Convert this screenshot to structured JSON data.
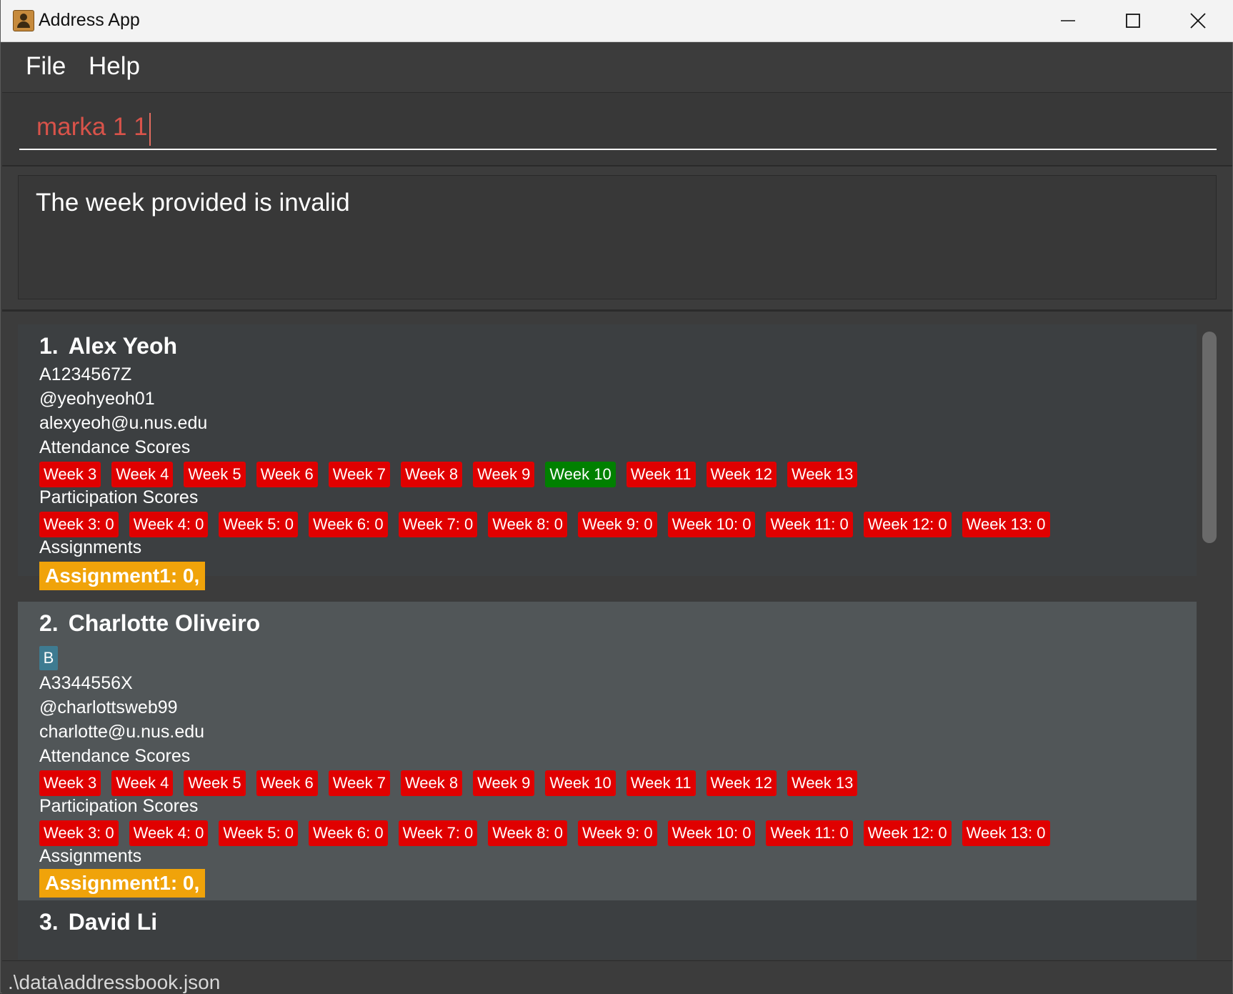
{
  "window": {
    "title": "Address App",
    "icon": "address-book-icon"
  },
  "menu": {
    "items": [
      {
        "label": "File"
      },
      {
        "label": "Help"
      }
    ]
  },
  "command": {
    "value": "marka 1 1",
    "color": "#d9534a"
  },
  "result": {
    "message": "The week provided is invalid"
  },
  "persons": [
    {
      "index": "1.",
      "name": "Alex Yeoh",
      "tags": [],
      "student_id": "A1234567Z",
      "telegram": "@yeohyeoh01",
      "email": "alexyeoh@u.nus.edu",
      "attendance_label": "Attendance Scores",
      "attendance": [
        {
          "label": "Week 3",
          "present": false
        },
        {
          "label": "Week 4",
          "present": false
        },
        {
          "label": "Week 5",
          "present": false
        },
        {
          "label": "Week 6",
          "present": false
        },
        {
          "label": "Week 7",
          "present": false
        },
        {
          "label": "Week 8",
          "present": false
        },
        {
          "label": "Week 9",
          "present": false
        },
        {
          "label": "Week 10",
          "present": true
        },
        {
          "label": "Week 11",
          "present": false
        },
        {
          "label": "Week 12",
          "present": false
        },
        {
          "label": "Week 13",
          "present": false
        }
      ],
      "participation_label": "Participation Scores",
      "participation": [
        "Week 3: 0",
        "Week 4: 0",
        "Week 5: 0",
        "Week 6: 0",
        "Week 7: 0",
        "Week 8: 0",
        "Week 9: 0",
        "Week 10: 0",
        "Week 11: 0",
        "Week 12: 0",
        "Week 13: 0"
      ],
      "assignments_label": "Assignments",
      "assignments": "Assignment1: 0,"
    },
    {
      "index": "2.",
      "name": "Charlotte Oliveiro",
      "tags": [
        "B"
      ],
      "student_id": "A3344556X",
      "telegram": "@charlottsweb99",
      "email": "charlotte@u.nus.edu",
      "attendance_label": "Attendance Scores",
      "attendance": [
        {
          "label": "Week 3",
          "present": false
        },
        {
          "label": "Week 4",
          "present": false
        },
        {
          "label": "Week 5",
          "present": false
        },
        {
          "label": "Week 6",
          "present": false
        },
        {
          "label": "Week 7",
          "present": false
        },
        {
          "label": "Week 8",
          "present": false
        },
        {
          "label": "Week 9",
          "present": false
        },
        {
          "label": "Week 10",
          "present": false
        },
        {
          "label": "Week 11",
          "present": false
        },
        {
          "label": "Week 12",
          "present": false
        },
        {
          "label": "Week 13",
          "present": false
        }
      ],
      "participation_label": "Participation Scores",
      "participation": [
        "Week 3: 0",
        "Week 4: 0",
        "Week 5: 0",
        "Week 6: 0",
        "Week 7: 0",
        "Week 8: 0",
        "Week 9: 0",
        "Week 10: 0",
        "Week 11: 0",
        "Week 12: 0",
        "Week 13: 0"
      ],
      "assignments_label": "Assignments",
      "assignments": "Assignment1: 0,"
    },
    {
      "index": "3.",
      "name": "David Li"
    }
  ],
  "status": {
    "path": ".\\data\\addressbook.json"
  },
  "colors": {
    "absent": "#e00000",
    "present": "#008000",
    "assignment": "#f0a30a",
    "tag": "#3e7b91"
  }
}
